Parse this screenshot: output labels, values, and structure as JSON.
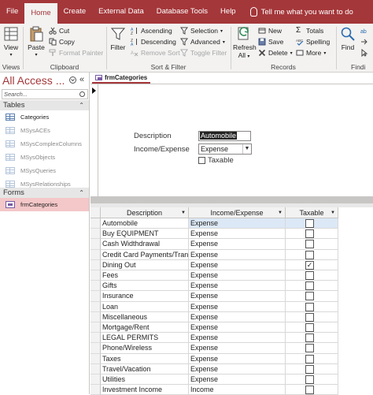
{
  "ribbon_tabs": [
    "File",
    "Home",
    "Create",
    "External Data",
    "Database Tools",
    "Help"
  ],
  "tell_me": "Tell me what you want to do",
  "groups": {
    "views": {
      "label": "Views",
      "view": "View"
    },
    "clipboard": {
      "label": "Clipboard",
      "paste": "Paste",
      "cut": "Cut",
      "copy": "Copy",
      "format_painter": "Format Painter"
    },
    "sort_filter": {
      "label": "Sort & Filter",
      "filter": "Filter",
      "ascending": "Ascending",
      "descending": "Descending",
      "remove_sort": "Remove Sort",
      "selection": "Selection",
      "advanced": "Advanced",
      "toggle_filter": "Toggle Filter"
    },
    "records": {
      "label": "Records",
      "refresh": "Refresh",
      "refresh2": "All",
      "new": "New",
      "save": "Save",
      "delete": "Delete",
      "totals": "Totals",
      "spelling": "Spelling",
      "more": "More"
    },
    "find": {
      "label": "Findi",
      "find": "Find"
    }
  },
  "nav": {
    "title": "All Access ...",
    "search_placeholder": "Search...",
    "tables_label": "Tables",
    "tables": [
      "Categories",
      "MSysACEs",
      "MSysComplexColumns",
      "MSysObjects",
      "MSysQueries",
      "MSysRelationships"
    ],
    "forms_label": "Forms",
    "forms": [
      "frmCategories"
    ]
  },
  "document": {
    "tab": "frmCategories",
    "form": {
      "description_label": "Description",
      "description_value": "Automobile",
      "income_label": "Income/Expense",
      "income_value": "Expense",
      "taxable_label": "Taxable"
    },
    "datasheet": {
      "columns": [
        "Description",
        "Income/Expense",
        "Taxable"
      ],
      "rows": [
        {
          "description": "Automobile",
          "type": "Expense",
          "taxable": false
        },
        {
          "description": "Buy EQUIPMENT",
          "type": "Expense",
          "taxable": false
        },
        {
          "description": "Cash Widthdrawal",
          "type": "Expense",
          "taxable": false
        },
        {
          "description": "Credit Card Payments/Trans",
          "type": "Expense",
          "taxable": false
        },
        {
          "description": "Dining Out",
          "type": "Expense",
          "taxable": true
        },
        {
          "description": "Fees",
          "type": "Expense",
          "taxable": false
        },
        {
          "description": "Gifts",
          "type": "Expense",
          "taxable": false
        },
        {
          "description": "Insurance",
          "type": "Expense",
          "taxable": false
        },
        {
          "description": "Loan",
          "type": "Expense",
          "taxable": false
        },
        {
          "description": "Miscellaneous",
          "type": "Expense",
          "taxable": false
        },
        {
          "description": "Mortgage/Rent",
          "type": "Expense",
          "taxable": false
        },
        {
          "description": "LEGAL PERMITS",
          "type": "Expense",
          "taxable": false
        },
        {
          "description": "Phone/Wireless",
          "type": "Expense",
          "taxable": false
        },
        {
          "description": "Taxes",
          "type": "Expense",
          "taxable": false
        },
        {
          "description": "Travel/Vacation",
          "type": "Expense",
          "taxable": false
        },
        {
          "description": "Utilities",
          "type": "Expense",
          "taxable": false
        },
        {
          "description": "Investment Income",
          "type": "Income",
          "taxable": false
        }
      ]
    }
  },
  "colors": {
    "accent": "#a4373a",
    "ribbon_bg": "#f3f2f1",
    "selected_nav": "#f4c7c8",
    "selected_cell": "#dce8f6"
  }
}
